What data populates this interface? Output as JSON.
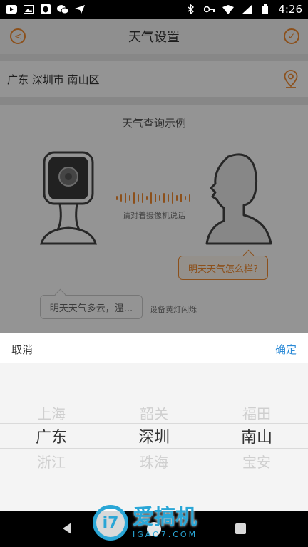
{
  "status_bar": {
    "time": "4:26"
  },
  "header": {
    "title": "天气设置"
  },
  "location": {
    "text": "广东 深圳市 南山区"
  },
  "example": {
    "title": "天气查询示例",
    "hint": "请对着摄像机说话",
    "user_bubble": "明天天气怎么样?",
    "device_bubble": "明天天气多云，温...",
    "blink_note": "设备黄灯闪烁"
  },
  "picker": {
    "cancel_label": "取消",
    "ok_label": "确定",
    "province": {
      "prev": "上海",
      "selected": "广东",
      "next": "浙江"
    },
    "city": {
      "prev": "韶关",
      "selected": "深圳",
      "next": "珠海"
    },
    "district": {
      "prev": "福田",
      "selected": "南山",
      "next": "宝安"
    }
  },
  "watermark": {
    "name": "爱搞机",
    "domain": "IGAO7.COM"
  },
  "colors": {
    "accent": "#f28b30",
    "link": "#2b8ad6",
    "watermark": "#2aa6d6"
  }
}
